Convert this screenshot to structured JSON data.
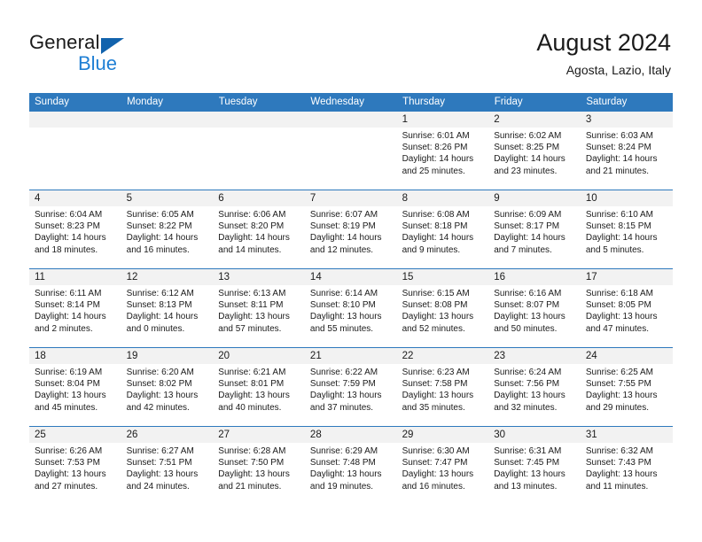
{
  "brand": {
    "name_top": "General",
    "name_bottom": "Blue",
    "triangle_color": "#1263ad",
    "blue_color": "#1f7fd4"
  },
  "header": {
    "title": "August 2024",
    "subtitle": "Agosta, Lazio, Italy"
  },
  "theme": {
    "header_blue": "#2e79bd",
    "day_band_gray": "#f2f2f2",
    "text": "#1a1a1a"
  },
  "calendar": {
    "weekday_headers": [
      "Sunday",
      "Monday",
      "Tuesday",
      "Wednesday",
      "Thursday",
      "Friday",
      "Saturday"
    ],
    "weeks": [
      [
        {
          "day": "",
          "sunrise": "",
          "sunset": "",
          "daylight_line1": "",
          "daylight_line2": ""
        },
        {
          "day": "",
          "sunrise": "",
          "sunset": "",
          "daylight_line1": "",
          "daylight_line2": ""
        },
        {
          "day": "",
          "sunrise": "",
          "sunset": "",
          "daylight_line1": "",
          "daylight_line2": ""
        },
        {
          "day": "",
          "sunrise": "",
          "sunset": "",
          "daylight_line1": "",
          "daylight_line2": ""
        },
        {
          "day": "1",
          "sunrise": "Sunrise: 6:01 AM",
          "sunset": "Sunset: 8:26 PM",
          "daylight_line1": "Daylight: 14 hours",
          "daylight_line2": "and 25 minutes."
        },
        {
          "day": "2",
          "sunrise": "Sunrise: 6:02 AM",
          "sunset": "Sunset: 8:25 PM",
          "daylight_line1": "Daylight: 14 hours",
          "daylight_line2": "and 23 minutes."
        },
        {
          "day": "3",
          "sunrise": "Sunrise: 6:03 AM",
          "sunset": "Sunset: 8:24 PM",
          "daylight_line1": "Daylight: 14 hours",
          "daylight_line2": "and 21 minutes."
        }
      ],
      [
        {
          "day": "4",
          "sunrise": "Sunrise: 6:04 AM",
          "sunset": "Sunset: 8:23 PM",
          "daylight_line1": "Daylight: 14 hours",
          "daylight_line2": "and 18 minutes."
        },
        {
          "day": "5",
          "sunrise": "Sunrise: 6:05 AM",
          "sunset": "Sunset: 8:22 PM",
          "daylight_line1": "Daylight: 14 hours",
          "daylight_line2": "and 16 minutes."
        },
        {
          "day": "6",
          "sunrise": "Sunrise: 6:06 AM",
          "sunset": "Sunset: 8:20 PM",
          "daylight_line1": "Daylight: 14 hours",
          "daylight_line2": "and 14 minutes."
        },
        {
          "day": "7",
          "sunrise": "Sunrise: 6:07 AM",
          "sunset": "Sunset: 8:19 PM",
          "daylight_line1": "Daylight: 14 hours",
          "daylight_line2": "and 12 minutes."
        },
        {
          "day": "8",
          "sunrise": "Sunrise: 6:08 AM",
          "sunset": "Sunset: 8:18 PM",
          "daylight_line1": "Daylight: 14 hours",
          "daylight_line2": "and 9 minutes."
        },
        {
          "day": "9",
          "sunrise": "Sunrise: 6:09 AM",
          "sunset": "Sunset: 8:17 PM",
          "daylight_line1": "Daylight: 14 hours",
          "daylight_line2": "and 7 minutes."
        },
        {
          "day": "10",
          "sunrise": "Sunrise: 6:10 AM",
          "sunset": "Sunset: 8:15 PM",
          "daylight_line1": "Daylight: 14 hours",
          "daylight_line2": "and 5 minutes."
        }
      ],
      [
        {
          "day": "11",
          "sunrise": "Sunrise: 6:11 AM",
          "sunset": "Sunset: 8:14 PM",
          "daylight_line1": "Daylight: 14 hours",
          "daylight_line2": "and 2 minutes."
        },
        {
          "day": "12",
          "sunrise": "Sunrise: 6:12 AM",
          "sunset": "Sunset: 8:13 PM",
          "daylight_line1": "Daylight: 14 hours",
          "daylight_line2": "and 0 minutes."
        },
        {
          "day": "13",
          "sunrise": "Sunrise: 6:13 AM",
          "sunset": "Sunset: 8:11 PM",
          "daylight_line1": "Daylight: 13 hours",
          "daylight_line2": "and 57 minutes."
        },
        {
          "day": "14",
          "sunrise": "Sunrise: 6:14 AM",
          "sunset": "Sunset: 8:10 PM",
          "daylight_line1": "Daylight: 13 hours",
          "daylight_line2": "and 55 minutes."
        },
        {
          "day": "15",
          "sunrise": "Sunrise: 6:15 AM",
          "sunset": "Sunset: 8:08 PM",
          "daylight_line1": "Daylight: 13 hours",
          "daylight_line2": "and 52 minutes."
        },
        {
          "day": "16",
          "sunrise": "Sunrise: 6:16 AM",
          "sunset": "Sunset: 8:07 PM",
          "daylight_line1": "Daylight: 13 hours",
          "daylight_line2": "and 50 minutes."
        },
        {
          "day": "17",
          "sunrise": "Sunrise: 6:18 AM",
          "sunset": "Sunset: 8:05 PM",
          "daylight_line1": "Daylight: 13 hours",
          "daylight_line2": "and 47 minutes."
        }
      ],
      [
        {
          "day": "18",
          "sunrise": "Sunrise: 6:19 AM",
          "sunset": "Sunset: 8:04 PM",
          "daylight_line1": "Daylight: 13 hours",
          "daylight_line2": "and 45 minutes."
        },
        {
          "day": "19",
          "sunrise": "Sunrise: 6:20 AM",
          "sunset": "Sunset: 8:02 PM",
          "daylight_line1": "Daylight: 13 hours",
          "daylight_line2": "and 42 minutes."
        },
        {
          "day": "20",
          "sunrise": "Sunrise: 6:21 AM",
          "sunset": "Sunset: 8:01 PM",
          "daylight_line1": "Daylight: 13 hours",
          "daylight_line2": "and 40 minutes."
        },
        {
          "day": "21",
          "sunrise": "Sunrise: 6:22 AM",
          "sunset": "Sunset: 7:59 PM",
          "daylight_line1": "Daylight: 13 hours",
          "daylight_line2": "and 37 minutes."
        },
        {
          "day": "22",
          "sunrise": "Sunrise: 6:23 AM",
          "sunset": "Sunset: 7:58 PM",
          "daylight_line1": "Daylight: 13 hours",
          "daylight_line2": "and 35 minutes."
        },
        {
          "day": "23",
          "sunrise": "Sunrise: 6:24 AM",
          "sunset": "Sunset: 7:56 PM",
          "daylight_line1": "Daylight: 13 hours",
          "daylight_line2": "and 32 minutes."
        },
        {
          "day": "24",
          "sunrise": "Sunrise: 6:25 AM",
          "sunset": "Sunset: 7:55 PM",
          "daylight_line1": "Daylight: 13 hours",
          "daylight_line2": "and 29 minutes."
        }
      ],
      [
        {
          "day": "25",
          "sunrise": "Sunrise: 6:26 AM",
          "sunset": "Sunset: 7:53 PM",
          "daylight_line1": "Daylight: 13 hours",
          "daylight_line2": "and 27 minutes."
        },
        {
          "day": "26",
          "sunrise": "Sunrise: 6:27 AM",
          "sunset": "Sunset: 7:51 PM",
          "daylight_line1": "Daylight: 13 hours",
          "daylight_line2": "and 24 minutes."
        },
        {
          "day": "27",
          "sunrise": "Sunrise: 6:28 AM",
          "sunset": "Sunset: 7:50 PM",
          "daylight_line1": "Daylight: 13 hours",
          "daylight_line2": "and 21 minutes."
        },
        {
          "day": "28",
          "sunrise": "Sunrise: 6:29 AM",
          "sunset": "Sunset: 7:48 PM",
          "daylight_line1": "Daylight: 13 hours",
          "daylight_line2": "and 19 minutes."
        },
        {
          "day": "29",
          "sunrise": "Sunrise: 6:30 AM",
          "sunset": "Sunset: 7:47 PM",
          "daylight_line1": "Daylight: 13 hours",
          "daylight_line2": "and 16 minutes."
        },
        {
          "day": "30",
          "sunrise": "Sunrise: 6:31 AM",
          "sunset": "Sunset: 7:45 PM",
          "daylight_line1": "Daylight: 13 hours",
          "daylight_line2": "and 13 minutes."
        },
        {
          "day": "31",
          "sunrise": "Sunrise: 6:32 AM",
          "sunset": "Sunset: 7:43 PM",
          "daylight_line1": "Daylight: 13 hours",
          "daylight_line2": "and 11 minutes."
        }
      ]
    ]
  }
}
